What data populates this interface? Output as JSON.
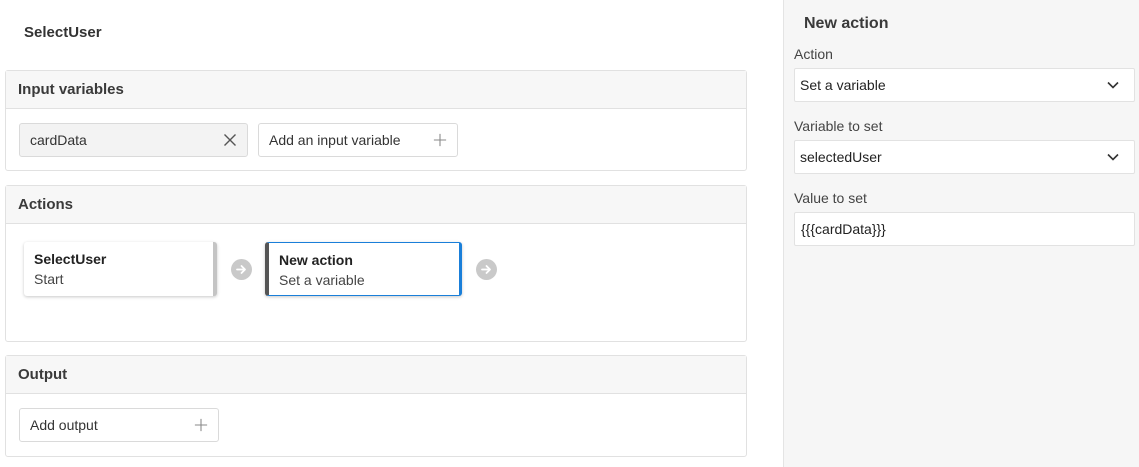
{
  "page": {
    "title": "SelectUser"
  },
  "input_variables": {
    "header": "Input variables",
    "variables": [
      {
        "name": "cardData"
      }
    ],
    "add_label": "Add an input variable"
  },
  "actions": {
    "header": "Actions",
    "cards": [
      {
        "title": "SelectUser",
        "subtitle": "Start"
      },
      {
        "title": "New action",
        "subtitle": "Set a variable"
      }
    ]
  },
  "output": {
    "header": "Output",
    "add_label": "Add output"
  },
  "panel": {
    "title": "New action",
    "action_label": "Action",
    "action_value": "Set a variable",
    "variable_label": "Variable to set",
    "variable_value": "selectedUser",
    "value_label": "Value to set",
    "value_value": "{{{cardData}}}"
  },
  "colors": {
    "accent": "#1a7fd9",
    "border": "#e1e1e1",
    "panel_bg": "#f6f6f6"
  },
  "icons": [
    "close-icon",
    "plus-icon",
    "arrow-right-icon",
    "chevron-down-icon"
  ]
}
